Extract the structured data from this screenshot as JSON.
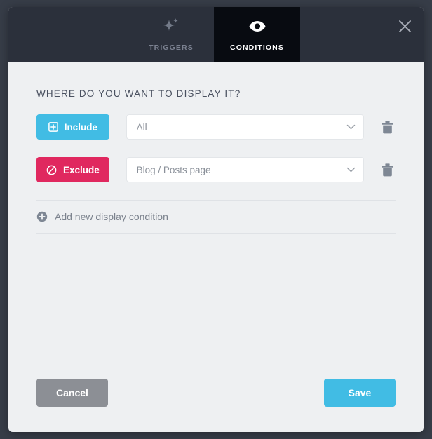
{
  "header": {
    "tabs": [
      {
        "label": "TRIGGERS",
        "icon": "sparkle-icon",
        "active": false
      },
      {
        "label": "CONDITIONS",
        "icon": "eye-icon",
        "active": true
      }
    ],
    "close_icon": "close-icon"
  },
  "main": {
    "section_title": "WHERE DO YOU WANT TO DISPLAY IT?",
    "conditions": [
      {
        "type_label": "Include",
        "type_icon": "plus-square-icon",
        "type_color": "#41bce4",
        "value": "All",
        "dropdown_icon": "chevron-down-icon",
        "delete_icon": "trash-icon"
      },
      {
        "type_label": "Exclude",
        "type_icon": "no-entry-icon",
        "type_color": "#e0285f",
        "value": "Blog / Posts page",
        "dropdown_icon": "chevron-down-icon",
        "delete_icon": "trash-icon"
      }
    ],
    "add_condition": {
      "label": "Add new display condition",
      "icon": "plus-circle-icon"
    }
  },
  "footer": {
    "cancel_label": "Cancel",
    "save_label": "Save",
    "save_color": "#41bce4",
    "cancel_color": "#8c8f95"
  }
}
